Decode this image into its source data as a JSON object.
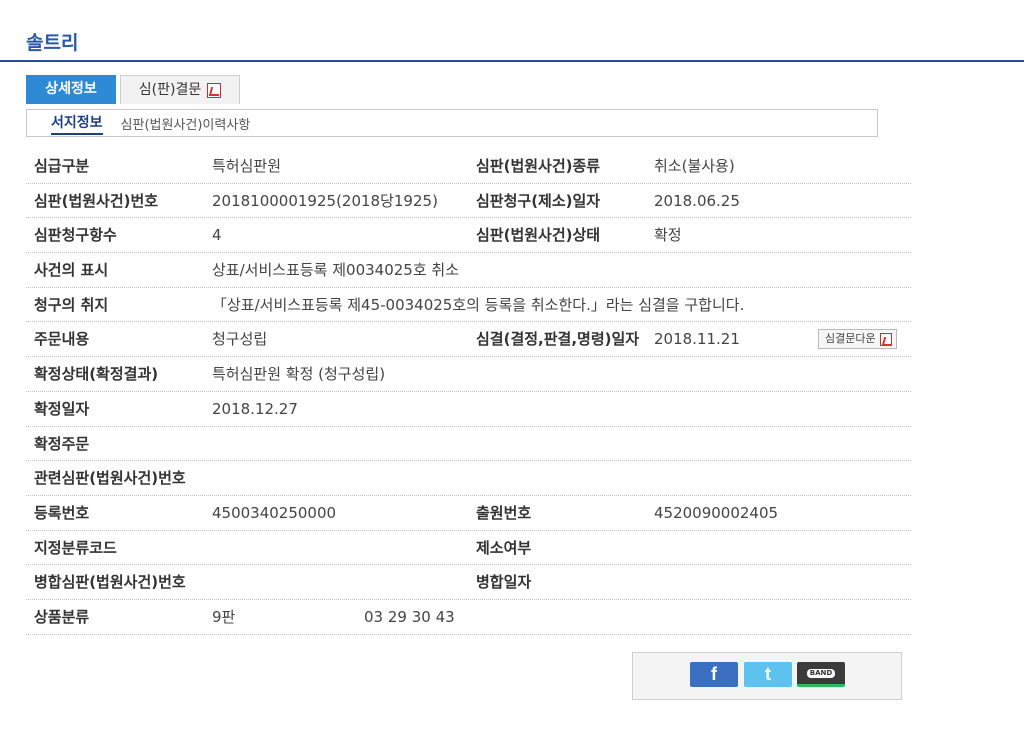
{
  "header": {
    "title": "솔트리"
  },
  "tabs": [
    {
      "label": "상세정보"
    },
    {
      "label": "심(판)결문"
    }
  ],
  "subtabs": [
    {
      "label": "서지정보"
    },
    {
      "label": "심판(법원사건)이력사항"
    }
  ],
  "fields": {
    "r1": {
      "l1": "심급구분",
      "v1": "특허심판원",
      "l2": "심판(법원사건)종류",
      "v2": "취소(불사용)"
    },
    "r2": {
      "l1": "심판(법원사건)번호",
      "v1": "2018100001925(2018당1925)",
      "l2": "심판청구(제소)일자",
      "v2": "2018.06.25"
    },
    "r3": {
      "l1": "심판청구항수",
      "v1": "4",
      "l2": "심판(법원사건)상태",
      "v2": "확정"
    },
    "r4": {
      "l1": "사건의 표시",
      "v1": "상표/서비스표등록 제0034025호 취소"
    },
    "r5": {
      "l1": "청구의 취지",
      "v1": "「상표/서비스표등록 제45-0034025호의 등록을 취소한다.」라는 심결을 구합니다."
    },
    "r6": {
      "l1": "주문내용",
      "v1": "청구성립",
      "l2": "심결(결정,판결,명령)일자",
      "v2": "2018.11.21",
      "download": "심결문다운"
    },
    "r7": {
      "l1": "확정상태(확정결과)",
      "v1": "특허심판원 확정 (청구성립)"
    },
    "r8": {
      "l1": "확정일자",
      "v1": "2018.12.27"
    },
    "r9": {
      "l1": "확정주문",
      "v1": ""
    },
    "r10": {
      "l1": "관련심판(법원사건)번호",
      "v1": ""
    },
    "r11": {
      "l1": "등록번호",
      "v1": "4500340250000",
      "l2": "출원번호",
      "v2": "4520090002405"
    },
    "r12": {
      "l1": "지정분류코드",
      "v1": "",
      "l2": "제소여부",
      "v2": ""
    },
    "r13": {
      "l1": "병합심판(법원사건)번호",
      "v1": "",
      "l2": "병합일자",
      "v2": ""
    },
    "r14": {
      "l1": "상품분류",
      "v1": "9판",
      "v1b": "03 29 30 43"
    }
  },
  "share": {
    "facebook": "f",
    "twitter": "t",
    "band": "BAND"
  }
}
